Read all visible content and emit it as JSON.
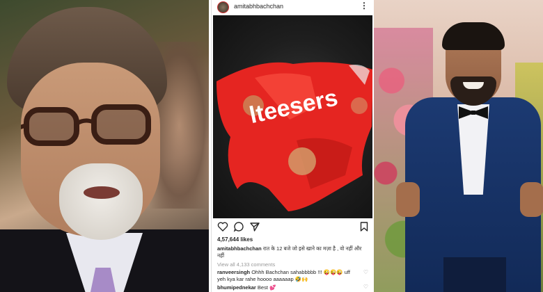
{
  "instagram_post": {
    "username": "amitabhbachchan",
    "likes": "4,57,644 likes",
    "caption_user": "amitabhbachchan",
    "caption_text": " रात के 12 बजे जो इसे खाने का मज़ा है , वो नहीं और नहीं",
    "view_all_comments": "View all 4,133 comments",
    "comments": [
      {
        "user": "ranveersingh",
        "text": " Ohhh Bachchan sahabbbbb !!! 😜😜😜 uff yeh kya kar rahe hoooo aaaaaap 🤣🙌"
      },
      {
        "user": "bhumipednekar",
        "text": " Best 💕"
      }
    ],
    "wrapper_text": "lteesers"
  },
  "colors": {
    "wrapper_red": "#e52521",
    "wrapper_text": "#ffffff",
    "heart_red": "#ed4956"
  },
  "icons": [
    "more-icon",
    "heart-icon",
    "comment-icon",
    "share-icon",
    "bookmark-icon",
    "comment-like-icon"
  ]
}
